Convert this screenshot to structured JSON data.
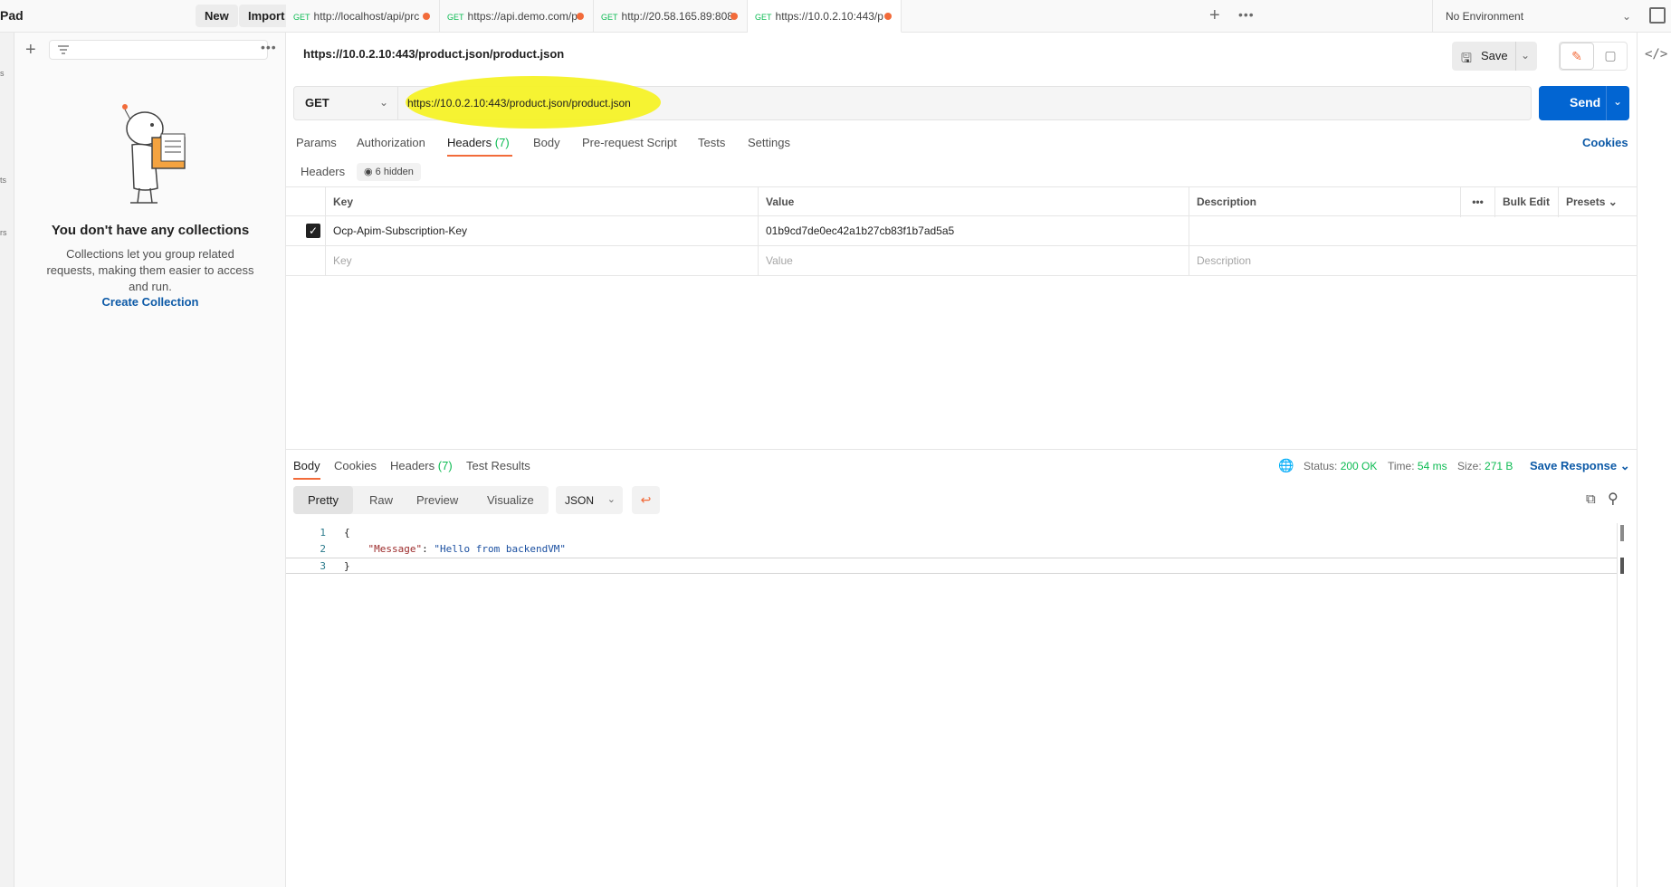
{
  "workspace": {
    "name": "Pad",
    "new_label": "New",
    "import_label": "Import"
  },
  "rail": {
    "items": [
      "s",
      "ts",
      "rs"
    ]
  },
  "sidebar": {
    "empty_title": "You don't have any collections",
    "empty_desc": "Collections let you group related requests, making them easier to access and run.",
    "create_label": "Create Collection"
  },
  "tabs": [
    {
      "method": "GET",
      "label": "http://localhost/api/prc",
      "unsaved": true
    },
    {
      "method": "GET",
      "label": "https://api.demo.com/p",
      "unsaved": true
    },
    {
      "method": "GET",
      "label": "http://20.58.165.89:808",
      "unsaved": true
    },
    {
      "method": "GET",
      "label": "https://10.0.2.10:443/p",
      "unsaved": true,
      "active": true
    }
  ],
  "environment": {
    "label": "No Environment"
  },
  "request": {
    "name": "https://10.0.2.10:443/product.json/product.json",
    "save_label": "Save",
    "method": "GET",
    "url": "https://10.0.2.10:443/product.json/product.json",
    "send_label": "Send",
    "highlight_color": "#f5f227"
  },
  "request_tabs": {
    "params": "Params",
    "authorization": "Authorization",
    "headers": "Headers",
    "headers_count": "(7)",
    "body": "Body",
    "prerequest": "Pre-request Script",
    "tests": "Tests",
    "settings": "Settings",
    "cookies": "Cookies"
  },
  "headers_section": {
    "title": "Headers",
    "hidden_label": "6 hidden",
    "columns": {
      "key": "Key",
      "value": "Value",
      "description": "Description",
      "bulk_edit": "Bulk Edit",
      "presets": "Presets"
    },
    "rows": [
      {
        "checked": true,
        "key": "Ocp-Apim-Subscription-Key",
        "value": "01b9cd7de0ec42a1b27cb83f1b7ad5a5",
        "description": ""
      }
    ],
    "placeholder": {
      "key": "Key",
      "value": "Value",
      "description": "Description"
    }
  },
  "response": {
    "tabs": {
      "body": "Body",
      "cookies": "Cookies",
      "headers": "Headers",
      "headers_count": "(7)",
      "test_results": "Test Results"
    },
    "status_label": "Status:",
    "status_value": "200 OK",
    "time_label": "Time:",
    "time_value": "54 ms",
    "size_label": "Size:",
    "size_value": "271 B",
    "save_response": "Save Response",
    "formats": {
      "pretty": "Pretty",
      "raw": "Raw",
      "preview": "Preview",
      "visualize": "Visualize"
    },
    "language": "JSON",
    "lines": [
      {
        "num": "1",
        "open": "{"
      },
      {
        "num": "2",
        "key": "\"Message\"",
        "sep": ": ",
        "value": "\"Hello from backendVM\""
      },
      {
        "num": "3",
        "close": "}"
      }
    ]
  },
  "colors": {
    "accent": "#f26b3a",
    "primary": "#0265d2",
    "success": "#0cbb52"
  }
}
